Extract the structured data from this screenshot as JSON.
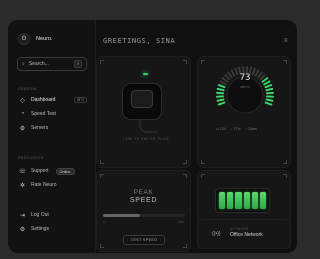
{
  "brand": {
    "name": "Neuro.",
    "logo_letter": "Θ"
  },
  "search": {
    "placeholder": "Search...",
    "button_glyph": "⌕"
  },
  "sidebar": {
    "general_label": "GENERAL",
    "general_items": [
      {
        "label": "Dashboard",
        "icon": "diamond-icon",
        "glyph": "◇",
        "shortcut": "⌘ D",
        "active": true
      },
      {
        "label": "Speed Test",
        "icon": "gauge-icon",
        "glyph": "◔"
      },
      {
        "label": "Servers",
        "icon": "server-icon",
        "glyph": "⚙"
      }
    ],
    "resources_label": "RESOURCES",
    "resource_items": [
      {
        "label": "Support",
        "icon": "support-icon",
        "glyph": "☏",
        "badge": "Online"
      },
      {
        "label": "Rate Neuro",
        "icon": "star-icon",
        "glyph": "✲"
      }
    ],
    "footer_items": [
      {
        "label": "Log Out",
        "icon": "logout-icon",
        "glyph": "⇥"
      },
      {
        "label": "Settings",
        "icon": "gear-icon",
        "glyph": "⚙"
      }
    ]
  },
  "header": {
    "greeting": "GREETINGS, SINA",
    "menu_glyph": "≡"
  },
  "router_card": {
    "label": "LINK TO ROUTER PLACE"
  },
  "gauge_card": {
    "value": "73",
    "unit": "MBIT/S",
    "level": 0.73,
    "stats": [
      "⊙ 124",
      "↓ 77%",
      "↑ 24ms"
    ]
  },
  "peak_card": {
    "title_top": "PEAK",
    "title_bottom": "SPEED",
    "slider_level": 0.45,
    "slider_min": "0",
    "slider_max": "1000",
    "button": "TEST SPEED"
  },
  "battery_card": {
    "label": "PHANDERTURBO GRID",
    "cells": 6,
    "level": 1.0
  },
  "network_card": {
    "label": "NETWORK",
    "value": "Office Network",
    "icon_glyph": "((•))"
  },
  "colors": {
    "accent_green": "#3cd46a",
    "background": "#101010"
  }
}
